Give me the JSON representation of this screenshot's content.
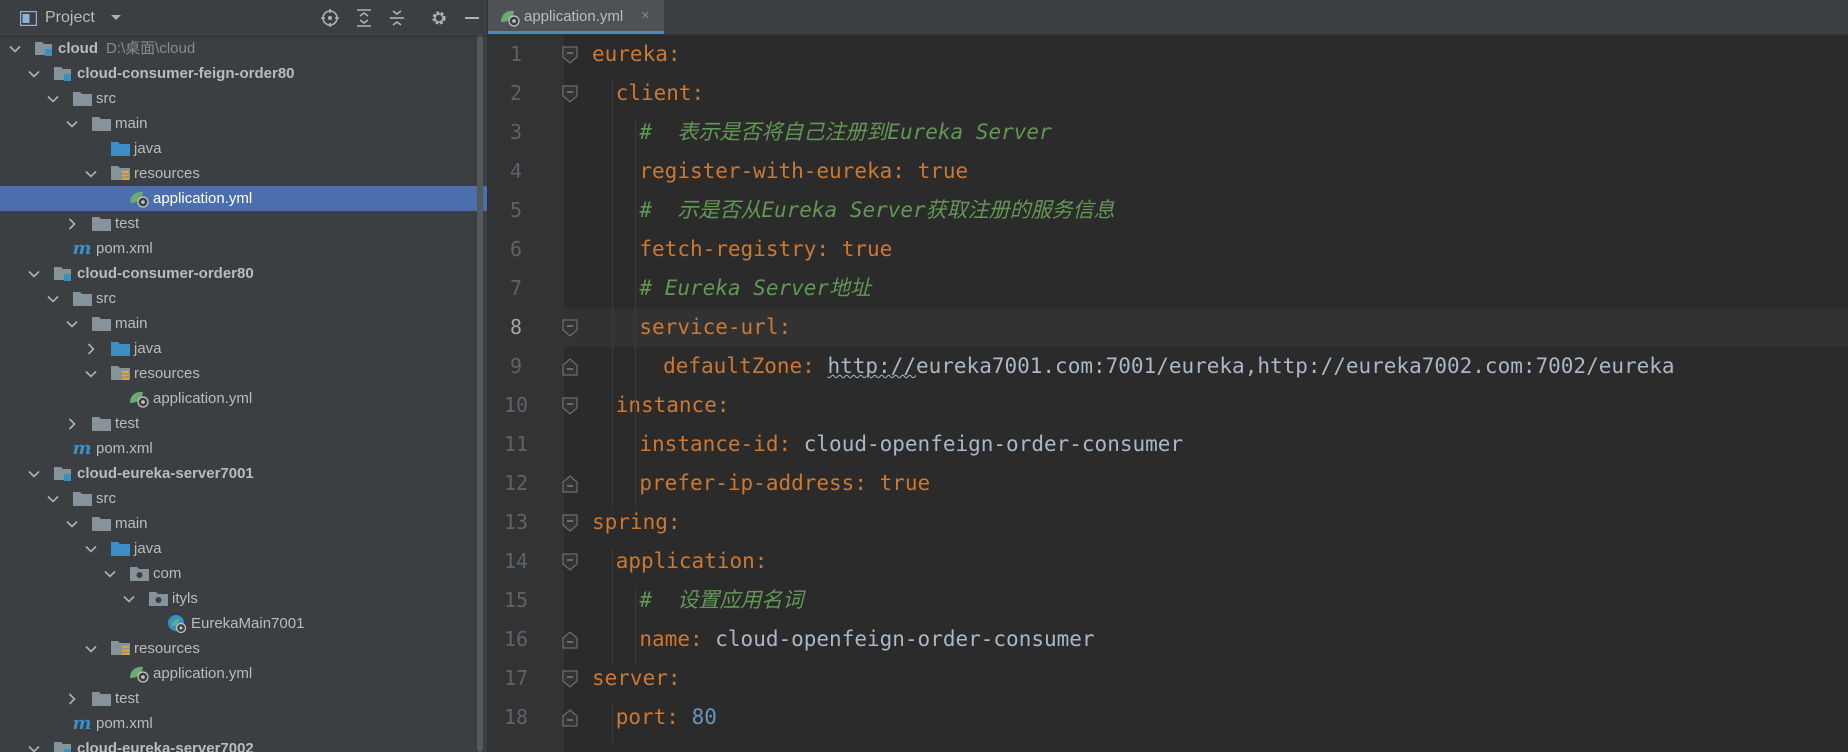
{
  "project_panel": {
    "title": "Project",
    "tree": [
      {
        "label": "cloud",
        "path": "D:\\桌面\\cloud",
        "depth": 0,
        "icon": "module",
        "chevron": "down",
        "bold": true
      },
      {
        "label": "cloud-consumer-feign-order80",
        "depth": 1,
        "icon": "module",
        "chevron": "down",
        "bold": true
      },
      {
        "label": "src",
        "depth": 2,
        "icon": "folder",
        "chevron": "down"
      },
      {
        "label": "main",
        "depth": 3,
        "icon": "folder",
        "chevron": "down"
      },
      {
        "label": "java",
        "depth": 4,
        "icon": "folder-blue",
        "chevron": "none"
      },
      {
        "label": "resources",
        "depth": 4,
        "icon": "folder-resources",
        "chevron": "down"
      },
      {
        "label": "application.yml",
        "depth": 5,
        "icon": "spring-yml",
        "chevron": "none",
        "selected": true
      },
      {
        "label": "test",
        "depth": 3,
        "icon": "folder",
        "chevron": "right"
      },
      {
        "label": "pom.xml",
        "depth": 2,
        "icon": "maven",
        "chevron": "none"
      },
      {
        "label": "cloud-consumer-order80",
        "depth": 1,
        "icon": "module",
        "chevron": "down",
        "bold": true
      },
      {
        "label": "src",
        "depth": 2,
        "icon": "folder",
        "chevron": "down"
      },
      {
        "label": "main",
        "depth": 3,
        "icon": "folder",
        "chevron": "down"
      },
      {
        "label": "java",
        "depth": 4,
        "icon": "folder-blue",
        "chevron": "right"
      },
      {
        "label": "resources",
        "depth": 4,
        "icon": "folder-resources",
        "chevron": "down"
      },
      {
        "label": "application.yml",
        "depth": 5,
        "icon": "spring-yml",
        "chevron": "none"
      },
      {
        "label": "test",
        "depth": 3,
        "icon": "folder",
        "chevron": "right"
      },
      {
        "label": "pom.xml",
        "depth": 2,
        "icon": "maven",
        "chevron": "none"
      },
      {
        "label": "cloud-eureka-server7001",
        "depth": 1,
        "icon": "module",
        "chevron": "down",
        "bold": true
      },
      {
        "label": "src",
        "depth": 2,
        "icon": "folder",
        "chevron": "down"
      },
      {
        "label": "main",
        "depth": 3,
        "icon": "folder",
        "chevron": "down"
      },
      {
        "label": "java",
        "depth": 4,
        "icon": "folder-blue",
        "chevron": "down"
      },
      {
        "label": "com",
        "depth": 5,
        "icon": "package",
        "chevron": "down"
      },
      {
        "label": "ityls",
        "depth": 6,
        "icon": "package",
        "chevron": "down"
      },
      {
        "label": "EurekaMain7001",
        "depth": 7,
        "icon": "spring-class",
        "chevron": "none"
      },
      {
        "label": "resources",
        "depth": 4,
        "icon": "folder-resources",
        "chevron": "down"
      },
      {
        "label": "application.yml",
        "depth": 5,
        "icon": "spring-yml",
        "chevron": "none"
      },
      {
        "label": "test",
        "depth": 3,
        "icon": "folder",
        "chevron": "right"
      },
      {
        "label": "pom.xml",
        "depth": 2,
        "icon": "maven",
        "chevron": "none"
      },
      {
        "label": "cloud-eureka-server7002",
        "depth": 1,
        "icon": "module",
        "chevron": "down",
        "bold": true
      }
    ]
  },
  "editor": {
    "tab_label": "application.yml",
    "tab_close": "×",
    "current_line": 8,
    "lines": [
      {
        "n": "1",
        "tokens": [
          {
            "t": "eureka",
            "c": "k"
          },
          {
            "t": ":",
            "c": "p"
          }
        ],
        "indent": 0
      },
      {
        "n": "2",
        "tokens": [
          {
            "t": "client",
            "c": "k"
          },
          {
            "t": ":",
            "c": "p"
          }
        ],
        "indent": 1
      },
      {
        "n": "3",
        "tokens": [
          {
            "t": "#  表示是否将自己注册到Eureka Server",
            "c": "c"
          }
        ],
        "indent": 2
      },
      {
        "n": "4",
        "tokens": [
          {
            "t": "register-with-eureka",
            "c": "k"
          },
          {
            "t": ": ",
            "c": "p"
          },
          {
            "t": "true",
            "c": "k"
          }
        ],
        "indent": 2
      },
      {
        "n": "5",
        "tokens": [
          {
            "t": "#  示是否从Eureka Server获取注册的服务信息",
            "c": "c"
          }
        ],
        "indent": 2
      },
      {
        "n": "6",
        "tokens": [
          {
            "t": "fetch-registry",
            "c": "k"
          },
          {
            "t": ": ",
            "c": "p"
          },
          {
            "t": "true",
            "c": "k"
          }
        ],
        "indent": 2
      },
      {
        "n": "7",
        "tokens": [
          {
            "t": "# Eureka Server地址",
            "c": "c"
          }
        ],
        "indent": 2
      },
      {
        "n": "8",
        "tokens": [
          {
            "t": "service-url",
            "c": "k"
          },
          {
            "t": ":",
            "c": "p"
          }
        ],
        "indent": 2
      },
      {
        "n": "9",
        "tokens": [
          {
            "t": "defaultZone",
            "c": "k"
          },
          {
            "t": ": ",
            "c": "p"
          },
          {
            "t": "http://eureka7001.com:7001/eureka,http://eureka7002.com:7002/eureka",
            "c": "v"
          }
        ],
        "indent": 3
      },
      {
        "n": "10",
        "tokens": [
          {
            "t": "instance",
            "c": "k"
          },
          {
            "t": ":",
            "c": "p"
          }
        ],
        "indent": 1
      },
      {
        "n": "11",
        "tokens": [
          {
            "t": "instance-id",
            "c": "k"
          },
          {
            "t": ": ",
            "c": "p"
          },
          {
            "t": "cloud-openfeign-order-consumer",
            "c": "v"
          }
        ],
        "indent": 2
      },
      {
        "n": "12",
        "tokens": [
          {
            "t": "prefer-ip-address",
            "c": "k"
          },
          {
            "t": ": ",
            "c": "p"
          },
          {
            "t": "true",
            "c": "k"
          }
        ],
        "indent": 2
      },
      {
        "n": "13",
        "tokens": [
          {
            "t": "spring",
            "c": "k"
          },
          {
            "t": ":",
            "c": "p"
          }
        ],
        "indent": 0
      },
      {
        "n": "14",
        "tokens": [
          {
            "t": "application",
            "c": "k"
          },
          {
            "t": ":",
            "c": "p"
          }
        ],
        "indent": 1
      },
      {
        "n": "15",
        "tokens": [
          {
            "t": "#  设置应用名词",
            "c": "c"
          }
        ],
        "indent": 2
      },
      {
        "n": "16",
        "tokens": [
          {
            "t": "name",
            "c": "k"
          },
          {
            "t": ": ",
            "c": "p"
          },
          {
            "t": "cloud-openfeign-order-consumer",
            "c": "v"
          }
        ],
        "indent": 2
      },
      {
        "n": "17",
        "tokens": [
          {
            "t": "server",
            "c": "k"
          },
          {
            "t": ":",
            "c": "p"
          }
        ],
        "indent": 0
      },
      {
        "n": "18",
        "tokens": [
          {
            "t": "port",
            "c": "k"
          },
          {
            "t": ": ",
            "c": "p"
          },
          {
            "t": "80",
            "c": "n"
          }
        ],
        "indent": 1
      }
    ],
    "folds": [
      {
        "line": 1,
        "type": "open"
      },
      {
        "line": 2,
        "type": "open"
      },
      {
        "line": 8,
        "type": "open"
      },
      {
        "line": 9,
        "type": "close"
      },
      {
        "line": 10,
        "type": "open"
      },
      {
        "line": 12,
        "type": "close"
      },
      {
        "line": 13,
        "type": "open"
      },
      {
        "line": 14,
        "type": "open"
      },
      {
        "line": 16,
        "type": "close"
      },
      {
        "line": 17,
        "type": "open"
      },
      {
        "line": 18,
        "type": "close"
      }
    ]
  }
}
